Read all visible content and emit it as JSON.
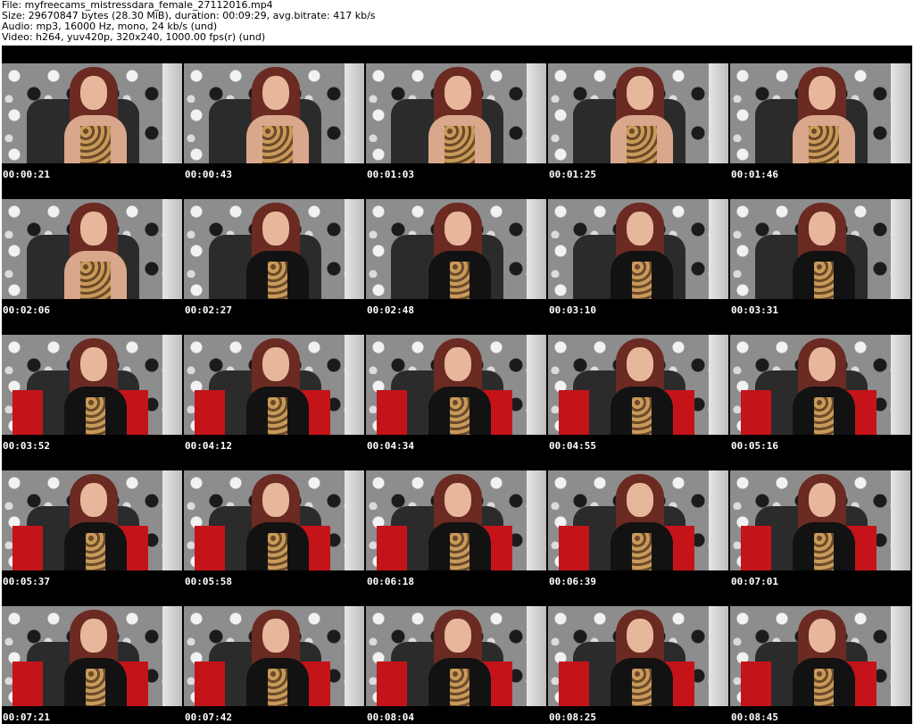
{
  "header": {
    "file_line": "File: myfreecams_mistressdara_female_27112016.mp4",
    "size_line": "Size: 29670847 bytes (28.30 MiB), duration: 00:09:29, avg.bitrate: 417 kb/s",
    "audio_line": "Audio: mp3, 16000 Hz, mono, 24 kb/s (und)",
    "video_line": "Video: h264, yuv420p, 320x240, 1000.00 fps(r) (und)"
  },
  "thumbnails": [
    {
      "time": "00:00:21",
      "outfit": "top"
    },
    {
      "time": "00:00:43",
      "outfit": "top"
    },
    {
      "time": "00:01:03",
      "outfit": "top"
    },
    {
      "time": "00:01:25",
      "outfit": "top"
    },
    {
      "time": "00:01:46",
      "outfit": "top"
    },
    {
      "time": "00:02:06",
      "outfit": "top"
    },
    {
      "time": "00:02:27",
      "outfit": "jacket"
    },
    {
      "time": "00:02:48",
      "outfit": "jacket"
    },
    {
      "time": "00:03:10",
      "outfit": "jacket"
    },
    {
      "time": "00:03:31",
      "outfit": "jacket"
    },
    {
      "time": "00:03:52",
      "outfit": "jacket"
    },
    {
      "time": "00:04:12",
      "outfit": "jacket"
    },
    {
      "time": "00:04:34",
      "outfit": "jacket"
    },
    {
      "time": "00:04:55",
      "outfit": "jacket"
    },
    {
      "time": "00:05:16",
      "outfit": "jacket"
    },
    {
      "time": "00:05:37",
      "outfit": "jacket"
    },
    {
      "time": "00:05:58",
      "outfit": "jacket"
    },
    {
      "time": "00:06:18",
      "outfit": "jacket"
    },
    {
      "time": "00:06:39",
      "outfit": "jacket"
    },
    {
      "time": "00:07:01",
      "outfit": "jacket"
    },
    {
      "time": "00:07:21",
      "outfit": "jacket"
    },
    {
      "time": "00:07:42",
      "outfit": "jacket"
    },
    {
      "time": "00:08:04",
      "outfit": "jacket"
    },
    {
      "time": "00:08:25",
      "outfit": "jacket"
    },
    {
      "time": "00:08:45",
      "outfit": "jacket"
    }
  ]
}
